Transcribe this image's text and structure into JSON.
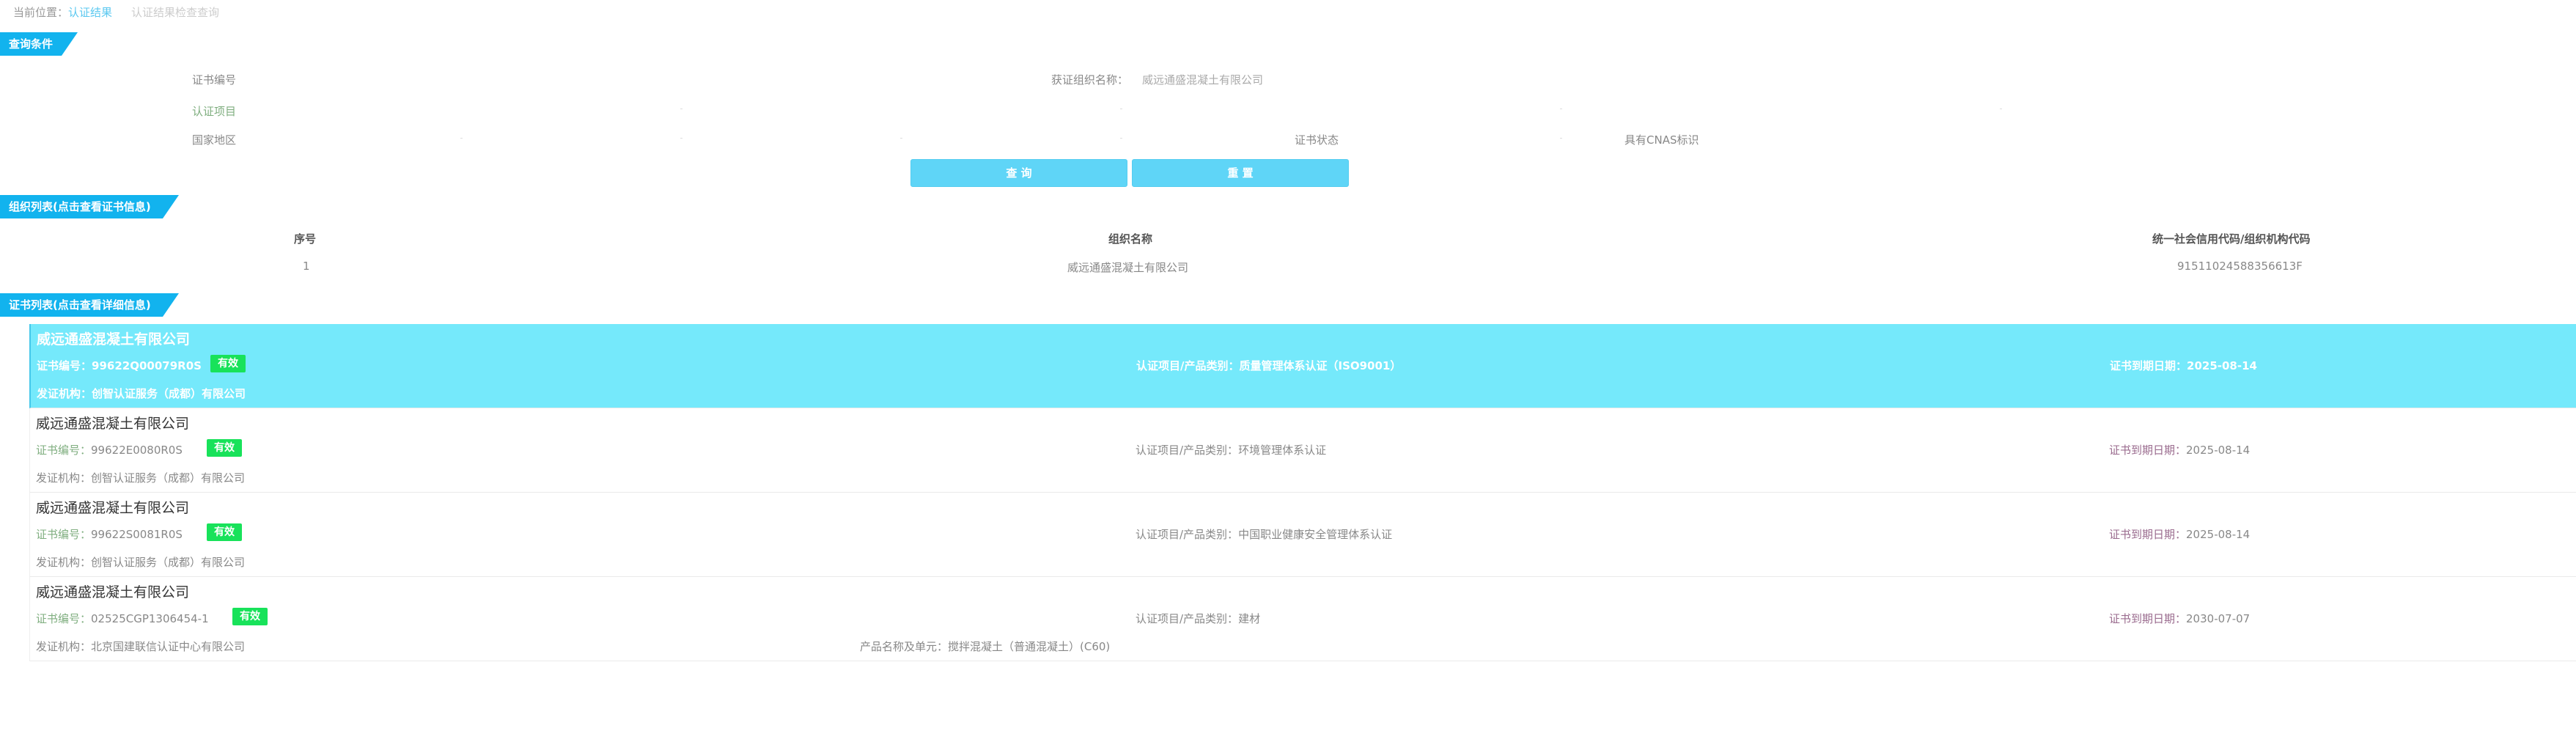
{
  "breadcrumb": {
    "prefix": "当前位置：",
    "current": "认证结果",
    "sub": "认证结果检查查询"
  },
  "sections": {
    "query": "查询条件",
    "org_list": "组织列表(点击查看证书信息)",
    "cert_list": "证书列表(点击查看详细信息)"
  },
  "query": {
    "cert_no_label": "证书编号",
    "org_name_label": "获证组织名称：",
    "org_name_value": "威远通盛混凝土有限公司",
    "project_label": "认证项目",
    "region_label": "国家地区",
    "status_label": "证书状态",
    "cnas_label": "具有CNAS标识",
    "search_button": "查 询",
    "reset_button": "重 置"
  },
  "org_table": {
    "headers": [
      "序号",
      "组织名称",
      "统一社会信用代码/组织机构代码"
    ],
    "rows": [
      {
        "index": "1",
        "name": "威远通盛混凝土有限公司",
        "code": "91511024588356613F"
      }
    ]
  },
  "certificates": [
    {
      "org": "威远通盛混凝土有限公司",
      "cert_no_key": "证书编号：",
      "cert_no": "99622Q00079R0S",
      "status": "有效",
      "project_key": "认证项目/产品类别：",
      "project": "质量管理体系认证（ISO9001）",
      "expiry_key": "证书到期日期：",
      "expiry": "2025-08-14",
      "issuer_key": "发证机构：",
      "issuer": "创智认证服务（成都）有限公司",
      "product_key": "",
      "product": ""
    },
    {
      "org": "威远通盛混凝土有限公司",
      "cert_no_key": "证书编号：",
      "cert_no": "99622E0080R0S",
      "status": "有效",
      "project_key": "认证项目/产品类别：",
      "project": "环境管理体系认证",
      "expiry_key": "证书到期日期：",
      "expiry": "2025-08-14",
      "issuer_key": "发证机构：",
      "issuer": "创智认证服务（成都）有限公司",
      "product_key": "",
      "product": ""
    },
    {
      "org": "威远通盛混凝土有限公司",
      "cert_no_key": "证书编号：",
      "cert_no": "99622S0081R0S",
      "status": "有效",
      "project_key": "认证项目/产品类别：",
      "project": "中国职业健康安全管理体系认证",
      "expiry_key": "证书到期日期：",
      "expiry": "2025-08-14",
      "issuer_key": "发证机构：",
      "issuer": "创智认证服务（成都）有限公司",
      "product_key": "",
      "product": ""
    },
    {
      "org": "威远通盛混凝土有限公司",
      "cert_no_key": "证书编号：",
      "cert_no": "02525CGP1306454-1",
      "status": "有效",
      "project_key": "认证项目/产品类别：",
      "project": "建材",
      "expiry_key": "证书到期日期：",
      "expiry": "2030-07-07",
      "issuer_key": "发证机构：",
      "issuer": "北京国建联信认证中心有限公司",
      "product_key": "产品名称及单元：",
      "product": "搅拌混凝土（普通混凝土）(C60)"
    }
  ],
  "colors": {
    "accent": "#12b3ee",
    "button": "#5fd5f7",
    "selected_row": "#75e9fb",
    "badge": "#18e25a"
  }
}
